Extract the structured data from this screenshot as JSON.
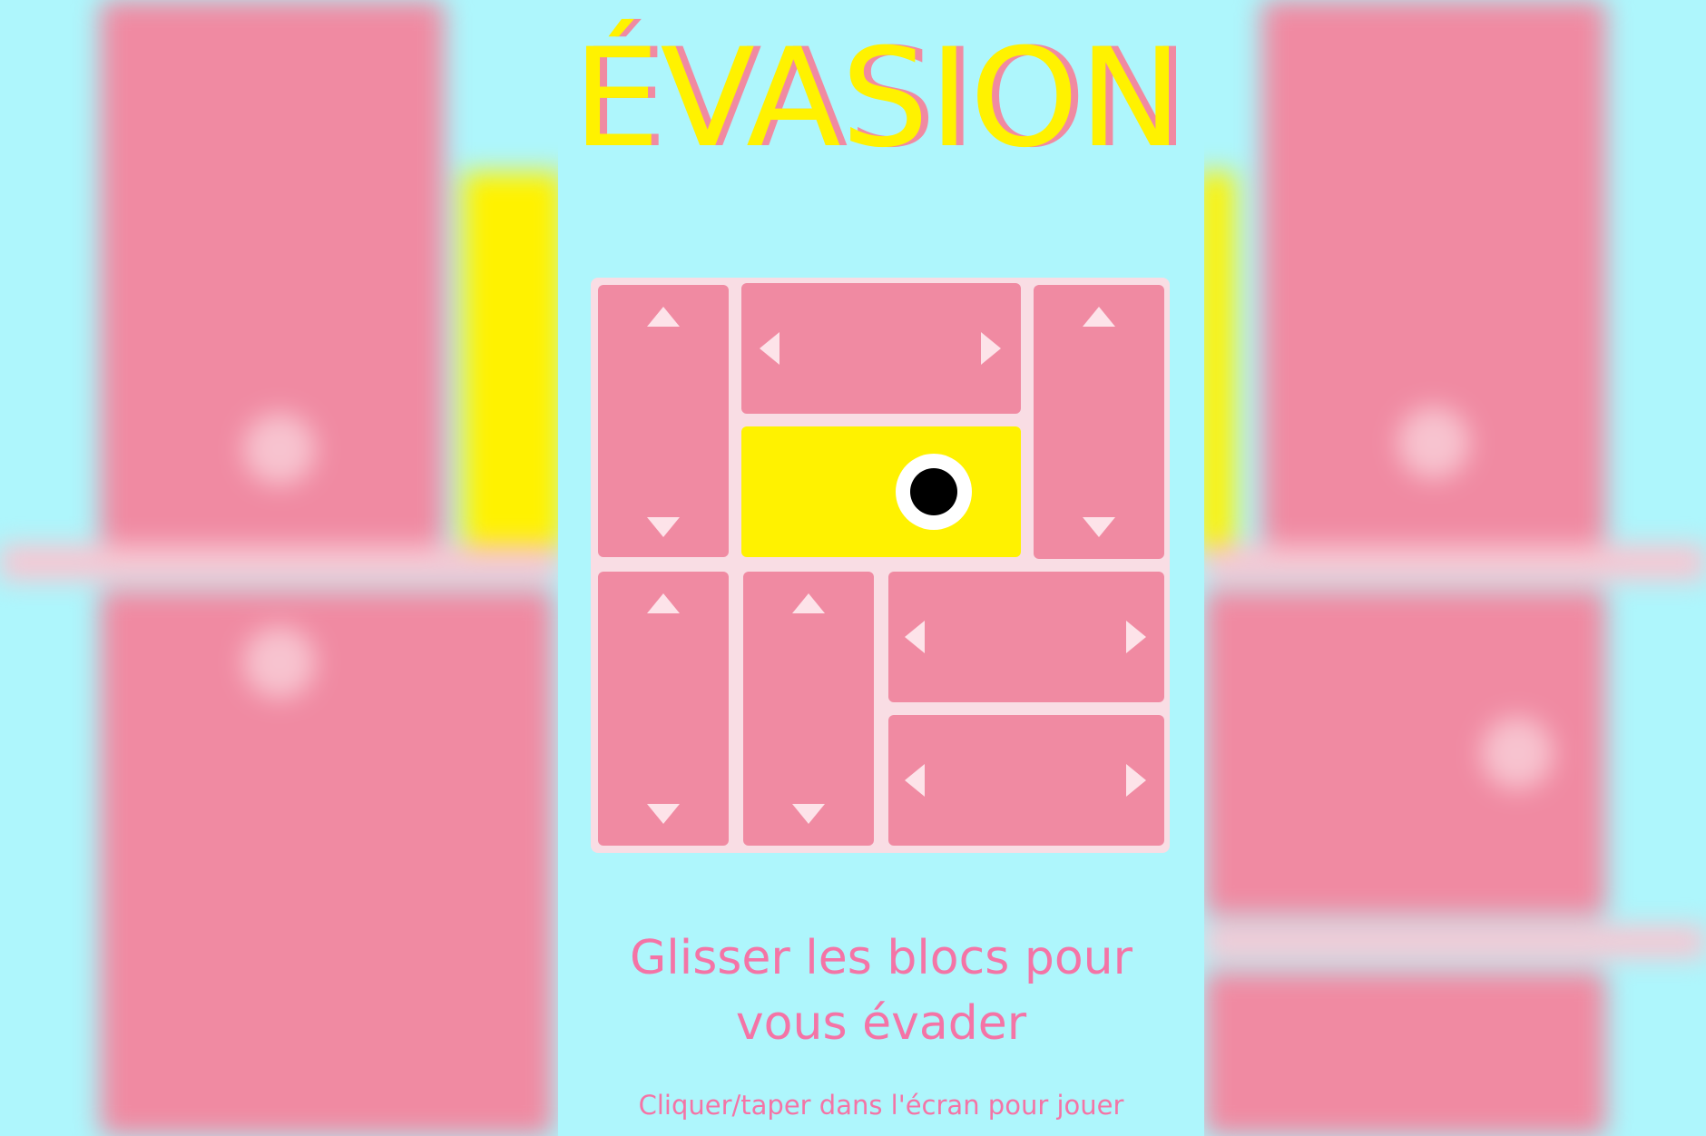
{
  "game": {
    "title": "ÉVASION",
    "instruction_line1": "Glisser les blocs pour",
    "instruction_line2": "vous évader",
    "hint": "Cliquer/taper dans l'écran pour jouer"
  },
  "colors": {
    "background": "#aef6fc",
    "block": "#f08aa2",
    "player_block": "#fff200",
    "title_fill": "#fff200",
    "title_shadow": "#f08aa2",
    "text": "#f474a6"
  },
  "board": {
    "columns": 4,
    "rows": 4,
    "blocks": [
      {
        "id": "vertical-top-left",
        "orientation": "vertical",
        "kind": "obstacle"
      },
      {
        "id": "horizontal-top-middle",
        "orientation": "horizontal",
        "kind": "obstacle"
      },
      {
        "id": "vertical-top-right",
        "orientation": "vertical",
        "kind": "obstacle"
      },
      {
        "id": "player",
        "orientation": "horizontal",
        "kind": "player"
      },
      {
        "id": "vertical-bottom-left",
        "orientation": "vertical",
        "kind": "obstacle"
      },
      {
        "id": "vertical-bottom-second",
        "orientation": "vertical",
        "kind": "obstacle"
      },
      {
        "id": "horizontal-bottom-right-upper",
        "orientation": "horizontal",
        "kind": "obstacle"
      },
      {
        "id": "horizontal-bottom-right-lower",
        "orientation": "horizontal",
        "kind": "obstacle"
      }
    ]
  },
  "icons": [
    "arrow-up-icon",
    "arrow-down-icon",
    "arrow-left-icon",
    "arrow-right-icon",
    "eye-icon"
  ]
}
